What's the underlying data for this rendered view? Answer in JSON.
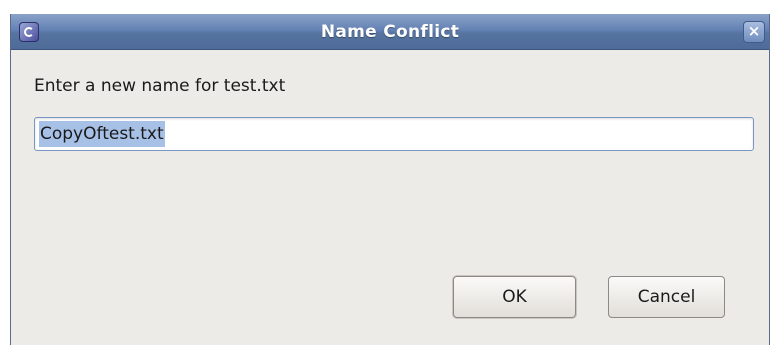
{
  "window": {
    "title": "Name Conflict",
    "close_glyph": "×",
    "app_icon": "eclipse-icon"
  },
  "dialog": {
    "prompt": "Enter a new name for test.txt",
    "input_value": "CopyOftest.txt"
  },
  "buttons": {
    "ok": "OK",
    "cancel": "Cancel"
  },
  "colors": {
    "titlebar": "#6482b4",
    "selection": "#a7c0e6",
    "background": "#edebe8"
  }
}
